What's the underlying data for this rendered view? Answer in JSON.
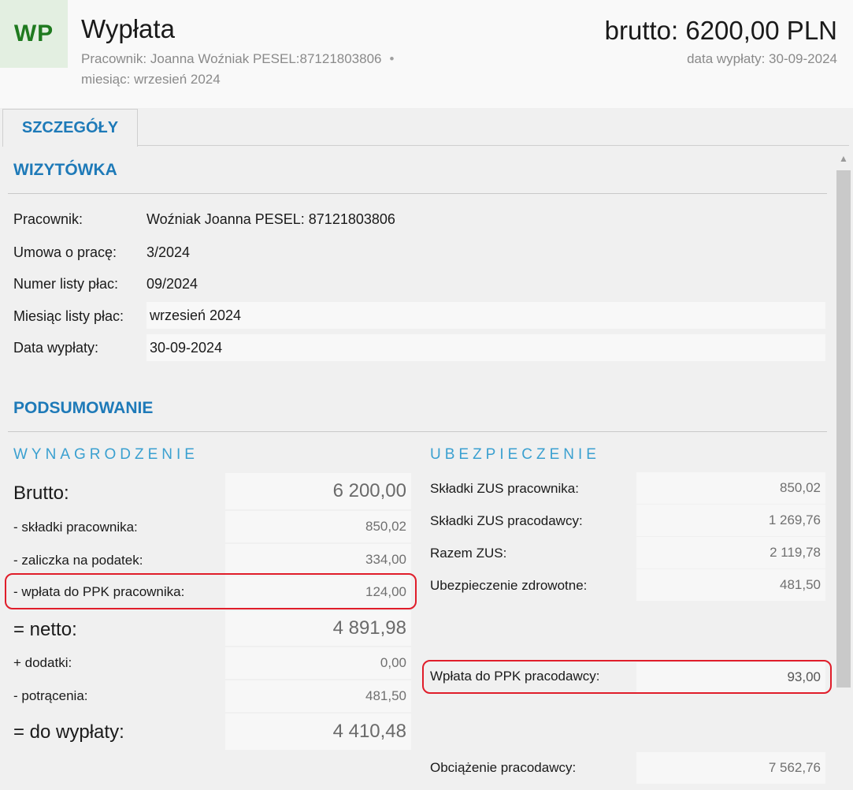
{
  "header": {
    "initials": "WP",
    "title": "Wypłata",
    "subtitle_line1": "Pracownik: Joanna Woźniak PESEL:87121803806",
    "subtitle_dot": "•",
    "subtitle_line2": "miesiąc: wrzesień 2024",
    "brutto": "brutto: 6200,00 PLN",
    "pay_date": "data wypłaty: 30-09-2024"
  },
  "tabs": [
    {
      "label": "SZCZEGÓŁY",
      "active": true
    }
  ],
  "wizytowka": {
    "title": "WIZYTÓWKA",
    "rows": [
      {
        "label": "Pracownik:",
        "value": "Woźniak Joanna PESEL: 87121803806"
      },
      {
        "label": "Umowa o pracę:",
        "value": "3/2024"
      },
      {
        "label": "Numer listy płac:",
        "value": "09/2024"
      },
      {
        "label": "Miesiąc listy płac:",
        "value": "wrzesień 2024"
      },
      {
        "label": "Data wypłaty:",
        "value": "30-09-2024"
      }
    ]
  },
  "podsumowanie": {
    "title": "PODSUMOWANIE",
    "wynagrodzenie": {
      "title": "WYNAGRODZENIE",
      "rows": [
        {
          "label": "Brutto:",
          "value": "6 200,00"
        },
        {
          "label": "- składki pracownika:",
          "value": "850,02"
        },
        {
          "label": "- zaliczka na podatek:",
          "value": "334,00"
        },
        {
          "label": "- wpłata do PPK pracownika:",
          "value": "124,00"
        },
        {
          "label": "= netto:",
          "value": "4 891,98"
        },
        {
          "label": "+ dodatki:",
          "value": "0,00"
        },
        {
          "label": "- potrącenia:",
          "value": "481,50"
        },
        {
          "label": "= do wypłaty:",
          "value": "4 410,48"
        }
      ]
    },
    "ubezpieczenie": {
      "title": "UBEZPIECZENIE",
      "rows": [
        {
          "label": "Składki ZUS pracownika:",
          "value": "850,02"
        },
        {
          "label": "Składki ZUS pracodawcy:",
          "value": "1 269,76"
        },
        {
          "label": "Razem ZUS:",
          "value": "2 119,78"
        },
        {
          "label": "Ubezpieczenie zdrowotne:",
          "value": "481,50"
        }
      ],
      "ppk_employer": {
        "label": "Wpłata do PPK pracodawcy:",
        "value": "93,00"
      },
      "employer_cost": {
        "label": "Obciążenie pracodawcy:",
        "value": "7 562,76"
      }
    }
  },
  "colors": {
    "accent": "#1e7ab8",
    "subheading": "#3aa0d0",
    "highlight": "#e01d2a",
    "avatar_text": "#1f7a1f"
  }
}
